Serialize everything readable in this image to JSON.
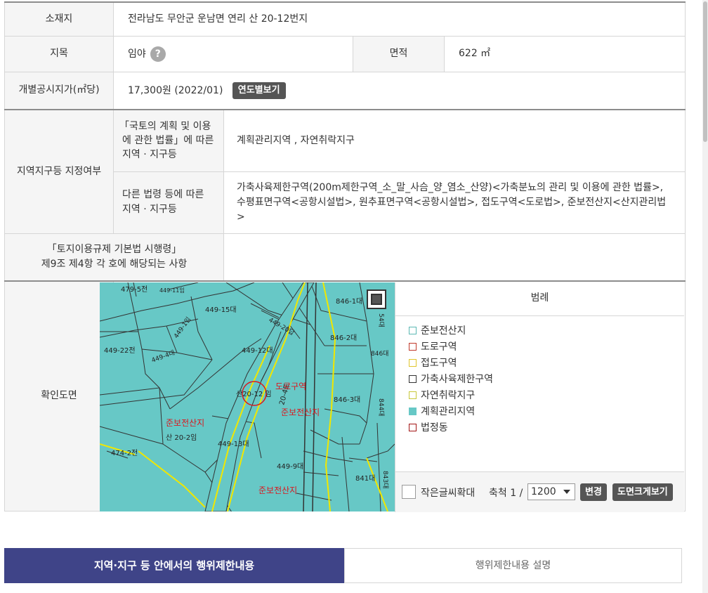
{
  "location": {
    "label": "소재지",
    "value": "전라남도 무안군 운남면 연리 산 20-12번지"
  },
  "land_category": {
    "label": "지목",
    "value": "임야",
    "help": "?"
  },
  "area": {
    "label": "면적",
    "value": "622 ㎡"
  },
  "price": {
    "label": "개별공시지가(㎡당)",
    "value": "17,300원 (2022/01)",
    "button": "연도별보기"
  },
  "zone": {
    "label": "지역지구등 지정여부",
    "national_law_label_l1": "「국토의 계획 및 이용",
    "national_law_label_l2": "에 관한 법률」에 따른",
    "national_law_label_l3": "지역 · 지구등",
    "national_law_value": "계획관리지역 , 자연취락지구",
    "other_law_label_l1": "다른 법령 등에 따른",
    "other_law_label_l2": "지역 · 지구등",
    "other_law_value": "가축사육제한구역(200m제한구역_소_말_사슴_양_염소_산양)<가축분뇨의 관리 및 이용에 관한 법률>, 수평표면구역<공항시설법>, 원추표면구역<공항시설법>, 접도구역<도로법>, 준보전산지<산지관리법>"
  },
  "enforcement": {
    "label_l1": "「토지이용규제 기본법 시행령」",
    "label_l2": "제9조 제4항 각 호에 해당되는 사항",
    "value": ""
  },
  "map": {
    "label": "확인도면",
    "labels": {
      "l1": "479-5전",
      "l2": "449-11임",
      "l3": "449-15대",
      "l4": "449-1임",
      "l5": "846-1대",
      "l6": "449-20답",
      "l7": "449-12대",
      "l8": "846-2대",
      "l9": "846대",
      "l10": "449-22전",
      "l11": "449-4대",
      "l12": "산20-12 임",
      "l13": "도로구역",
      "l14": "846-3대",
      "l15": "준보전산지",
      "l16": "준보전산지",
      "l17": "산 20-2임",
      "l18": "449-13대",
      "l19": "474-2전",
      "l20": "449-9대",
      "l21": "841대",
      "l22": "준보전산지",
      "l23": "844대",
      "l24": "843대",
      "l25": "54대",
      "l26": "20-4도"
    },
    "colors": {
      "fill": "#67c8c6",
      "red": "#d9181f",
      "yellow": "#f1e700",
      "line": "#333333"
    }
  },
  "legend": {
    "title": "범례",
    "items": [
      {
        "label": "준보전산지",
        "color": "#5bb8b3",
        "filled": false
      },
      {
        "label": "도로구역",
        "color": "#c0392b",
        "filled": false
      },
      {
        "label": "접도구역",
        "color": "#e0c52d",
        "filled": false
      },
      {
        "label": "가축사육제한구역",
        "color": "#333333",
        "filled": false
      },
      {
        "label": "자연취락지구",
        "color": "#c8c83a",
        "filled": false
      },
      {
        "label": "계획관리지역",
        "color": "#67c8c6",
        "filled": true
      },
      {
        "label": "법정동",
        "color": "#a31515",
        "filled": false
      }
    ]
  },
  "map_tools": {
    "small_font_label": "작은글씨확대",
    "scale_label": "축척 1 /",
    "scale_value": "1200",
    "change_button": "변경",
    "bigmap_button": "도면크게보기"
  },
  "tabs": {
    "active": "지역·지구 등 안에서의 행위제한내용",
    "inactive": "행위제한내용 설명"
  }
}
